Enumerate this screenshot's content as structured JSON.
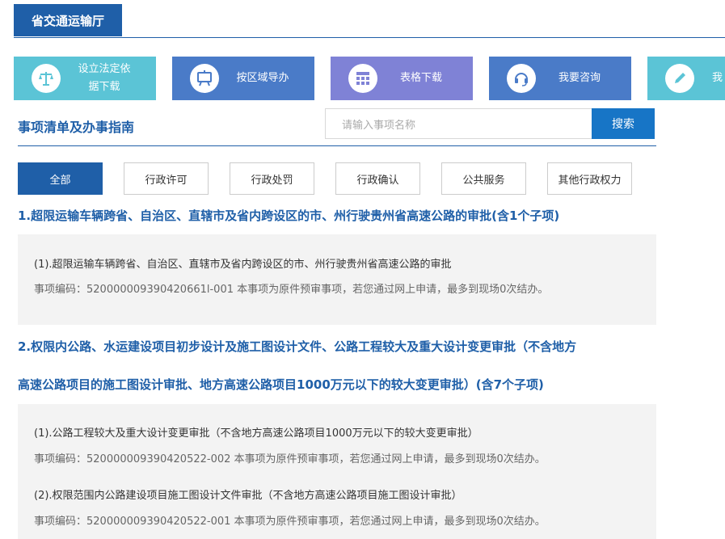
{
  "header": {
    "title": "省交通运输厅"
  },
  "tiles": [
    {
      "label_line1": "设立法定依",
      "label_line2": "据下载",
      "icon": "scales-icon"
    },
    {
      "label": "按区域导办",
      "icon": "easel-icon"
    },
    {
      "label": "表格下载",
      "icon": "grid-icon"
    },
    {
      "label": "我要咨询",
      "icon": "headset-icon"
    },
    {
      "label": "我",
      "icon": "pencil-icon"
    }
  ],
  "section": {
    "title": "事项清单及办事指南"
  },
  "search": {
    "placeholder": "请输入事项名称",
    "button": "搜索"
  },
  "filters": [
    "全部",
    "行政许可",
    "行政处罚",
    "行政确认",
    "公共服务",
    "其他行政权力"
  ],
  "items": [
    {
      "title": "1.超限运输车辆跨省、自治区、直辖市及省内跨设区的市、州行驶贵州省高速公路的审批(含1个子项)",
      "subitems": [
        {
          "name": "(1).超限运输车辆跨省、自治区、直辖市及省内跨设区的市、州行驶贵州省高速公路的审批",
          "meta": "事项编码：520000009390420661l-001 本事项为原件预审事项，若您通过网上申请，最多到现场0次结办。"
        }
      ]
    },
    {
      "title_line1": "2.权限内公路、水运建设项目初步设计及施工图设计文件、公路工程较大及重大设计变更审批（不含地方",
      "title_line2": "高速公路项目的施工图设计审批、地方高速公路项目1000万元以下的较大变更审批）(含7个子项)",
      "subitems": [
        {
          "name": "(1).公路工程较大及重大设计变更审批（不含地方高速公路项目1000万元以下的较大变更审批）",
          "meta": "事项编码：520000009390420522-002 本事项为原件预审事项，若您通过网上申请，最多到现场0次结办。"
        },
        {
          "name": "(2).权限范围内公路建设项目施工图设计文件审批（不含地方高速公路项目施工图设计审批）",
          "meta": "事项编码：520000009390420522-001 本事项为原件预审事项，若您通过网上申请，最多到现场0次结办。"
        }
      ]
    }
  ],
  "colors": {
    "primary": "#1f5fa8",
    "tile_cyan": "#5bc4d6",
    "tile_blue": "#4a7bc8",
    "tile_violet": "#7f82d6",
    "search_btn": "#1775c6"
  }
}
